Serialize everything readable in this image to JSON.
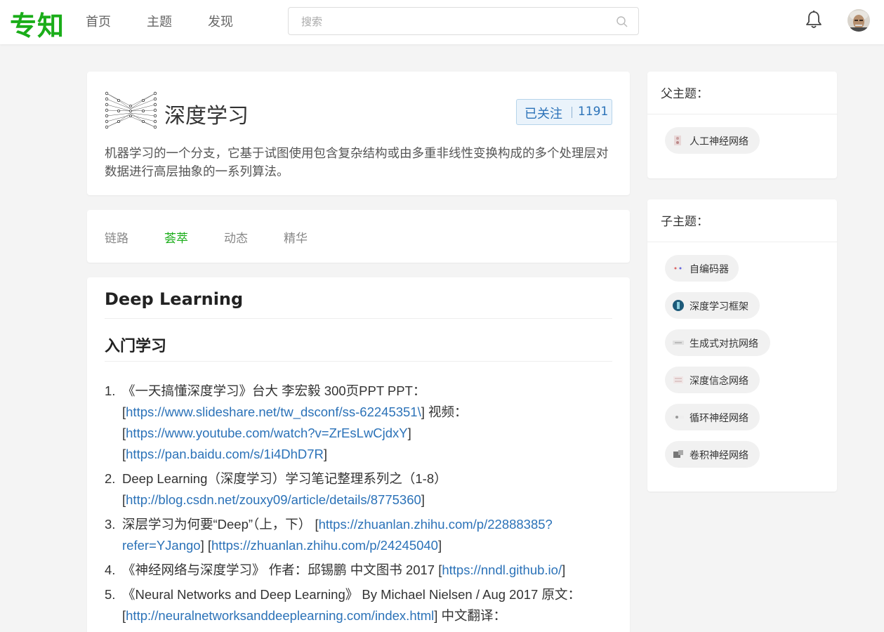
{
  "header": {
    "logo": "专知",
    "nav": [
      "首页",
      "主题",
      "发现"
    ],
    "search_placeholder": "搜索"
  },
  "topic": {
    "title": "深度学习",
    "follow_label": "已关注",
    "follow_count": "1191",
    "description": "机器学习的一个分支，它基于试图使用包含复杂结构或由多重非线性变换构成的多个处理层对数据进行高层抽象的一系列算法。"
  },
  "tabs": [
    "链路",
    "荟萃",
    "动态",
    "精华"
  ],
  "content": {
    "h1": "Deep Learning",
    "h2": "入门学习",
    "items": [
      {
        "num": "1.",
        "parts": [
          {
            "t": "《一天搞懂深度学习》台大 李宏毅 300页PPT PPT：[",
            "link": false
          },
          {
            "t": "https://www.slideshare.net/tw_dsconf/ss-62245351\\",
            "link": true
          },
          {
            "t": "] 视频：[",
            "link": false
          },
          {
            "t": "https://www.youtube.com/watch?v=ZrEsLwCjdxY",
            "link": true
          },
          {
            "t": "] [",
            "link": false
          },
          {
            "t": "https://pan.baidu.com/s/1i4DhD7R",
            "link": true
          },
          {
            "t": "]",
            "link": false
          }
        ]
      },
      {
        "num": "2.",
        "parts": [
          {
            "t": "Deep Learning（深度学习）学习笔记整理系列之（1-8）[",
            "link": false
          },
          {
            "t": "http://blog.csdn.net/zouxy09/article/details/8775360",
            "link": true
          },
          {
            "t": "]",
            "link": false
          }
        ]
      },
      {
        "num": "3.",
        "parts": [
          {
            "t": "深层学习为何要“Deep”（上，下） [",
            "link": false
          },
          {
            "t": "https://zhuanlan.zhihu.com/p/22888385?refer=YJango",
            "link": true
          },
          {
            "t": "] [",
            "link": false
          },
          {
            "t": "https://zhuanlan.zhihu.com/p/24245040",
            "link": true
          },
          {
            "t": "]",
            "link": false
          }
        ]
      },
      {
        "num": "4.",
        "parts": [
          {
            "t": "《神经网络与深度学习》 作者：邱锡鹏 中文图书 2017 [",
            "link": false
          },
          {
            "t": "https://nndl.github.io/",
            "link": true
          },
          {
            "t": "]",
            "link": false
          }
        ]
      },
      {
        "num": "5.",
        "parts": [
          {
            "t": "《Neural Networks and Deep Learning》 By Michael Nielsen / Aug 2017 原文：[",
            "link": false
          },
          {
            "t": "http://neuralnetworksanddeeplearning.com/index.html",
            "link": true
          },
          {
            "t": "] 中文翻译：",
            "link": false
          }
        ]
      }
    ]
  },
  "sidebar": {
    "parent_title": "父主题：",
    "parents": [
      "人工神经网络"
    ],
    "child_title": "子主题：",
    "children": [
      "自编码器",
      "深度学习框架",
      "生成式对抗网络",
      "深度信念网络",
      "循环神经网络",
      "卷积神经网络"
    ]
  },
  "colors": {
    "brand_green": "#1aad19",
    "link_blue": "#2b72b8",
    "follow_bg": "#eaf3fb"
  }
}
